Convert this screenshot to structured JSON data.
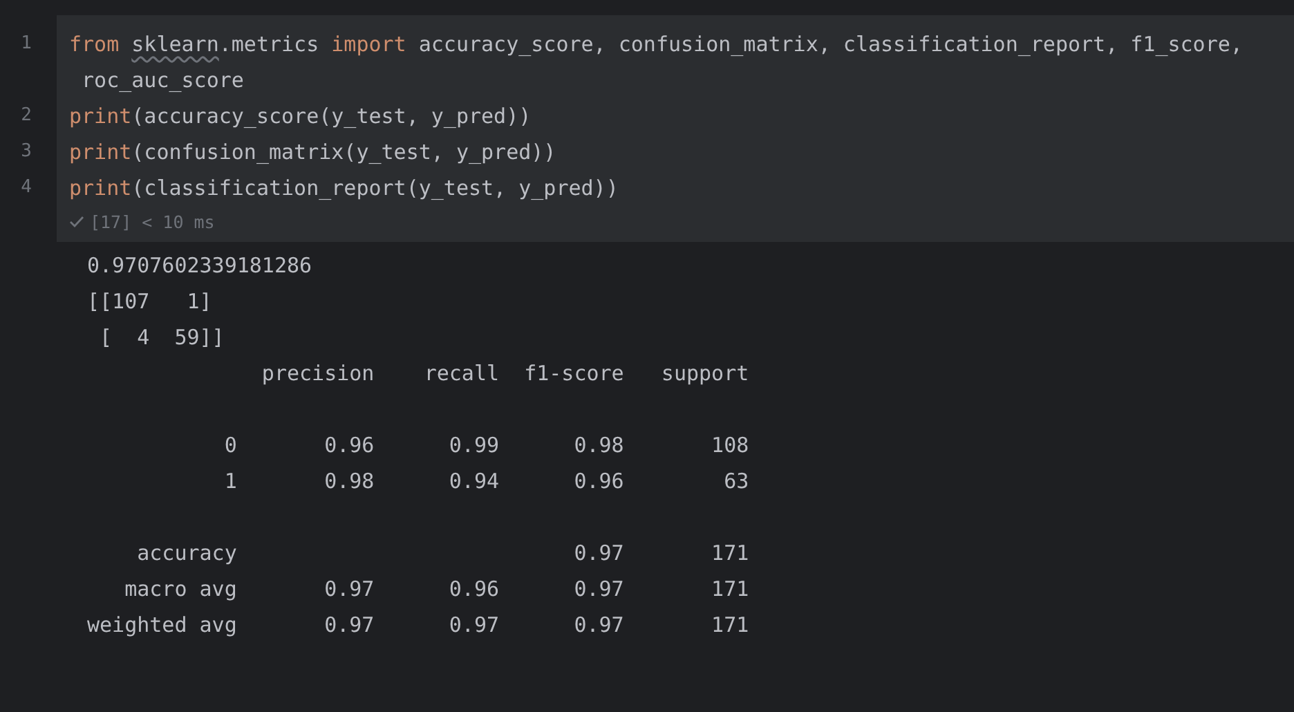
{
  "cell": {
    "lines": [
      {
        "number": "1",
        "tokens": [
          {
            "text": "from ",
            "kind": "keyword"
          },
          {
            "text": "sklearn",
            "kind": "warning"
          },
          {
            "text": ".metrics ",
            "kind": "plain"
          },
          {
            "text": "import",
            "kind": "keyword"
          },
          {
            "text": " accuracy_score, confusion_matrix, classification_report, f1_score,",
            "kind": "plain"
          }
        ],
        "continuation": " roc_auc_score"
      },
      {
        "number": "2",
        "tokens": [
          {
            "text": "print",
            "kind": "keyword"
          },
          {
            "text": "(accuracy_score(y_test, y_pred))",
            "kind": "plain"
          }
        ]
      },
      {
        "number": "3",
        "tokens": [
          {
            "text": "print",
            "kind": "keyword"
          },
          {
            "text": "(confusion_matrix(y_test, y_pred))",
            "kind": "plain"
          }
        ]
      },
      {
        "number": "4",
        "tokens": [
          {
            "text": "print",
            "kind": "keyword"
          },
          {
            "text": "(classification_report(y_test, y_pred))",
            "kind": "plain"
          }
        ]
      }
    ],
    "status": {
      "succeeded": true,
      "text": "[17] < 10 ms"
    }
  },
  "output": [
    {
      "lines": [
        "0.9707602339181286",
        "[[107   1]",
        " [  4  59]]",
        "              precision    recall  f1-score   support"
      ]
    },
    {
      "lines": [
        "           0       0.96      0.99      0.98       108",
        "           1       0.98      0.94      0.96        63"
      ]
    },
    {
      "lines": [
        "    accuracy                           0.97       171",
        "   macro avg       0.97      0.96      0.97       171",
        "weighted avg       0.97      0.97      0.97       171"
      ]
    }
  ]
}
